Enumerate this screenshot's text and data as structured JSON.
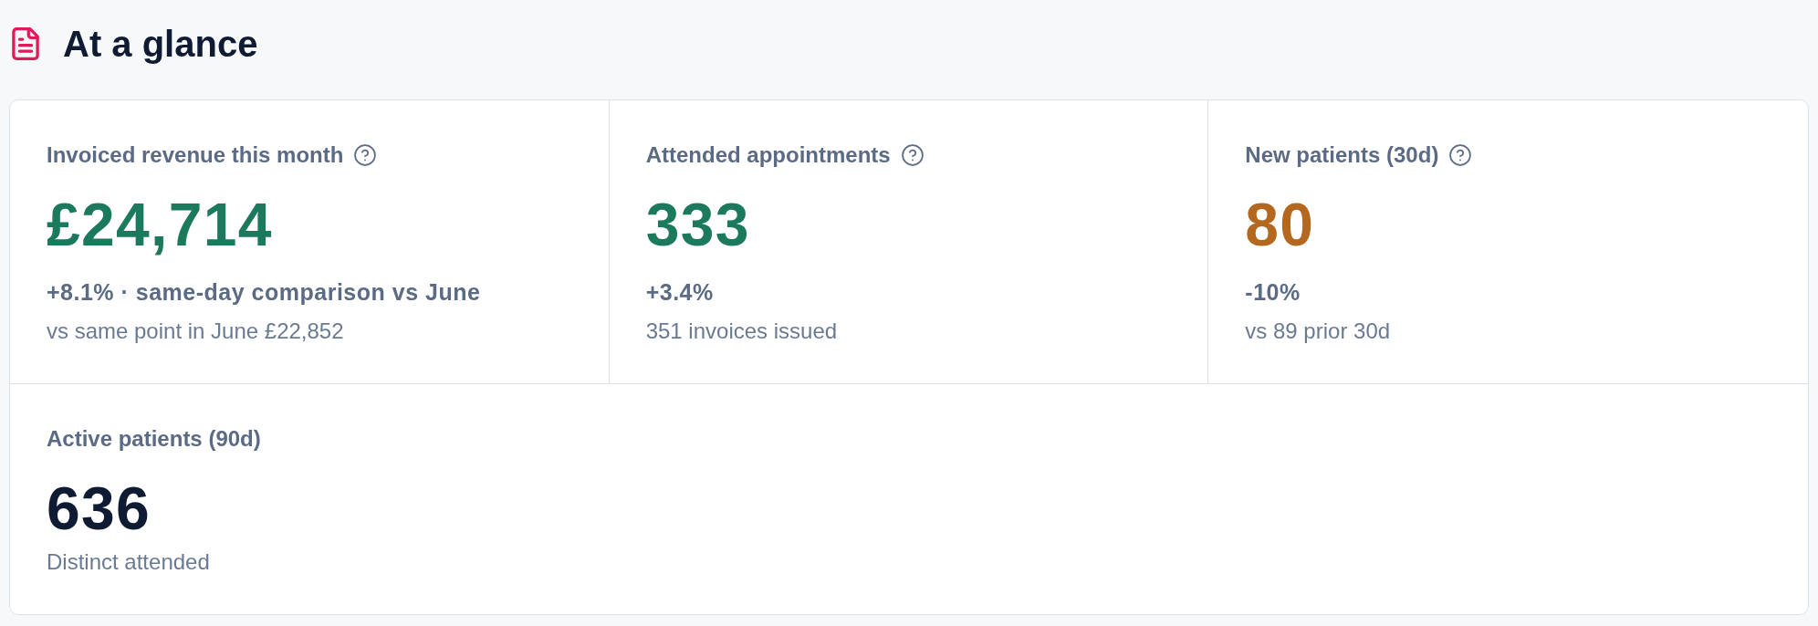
{
  "header": {
    "title": "At a glance"
  },
  "metrics": [
    {
      "label": "Invoiced revenue this month",
      "help": true,
      "value": "£24,714",
      "color": "#1b7a5c",
      "change": "+8.1% · same-day comparison vs June",
      "note": "vs same point in June £22,852"
    },
    {
      "label": "Attended appointments",
      "help": true,
      "value": "333",
      "color": "#1b7a5c",
      "change": "+3.4%",
      "note": "351 invoices issued"
    },
    {
      "label": "New patients (30d)",
      "help": true,
      "value": "80",
      "color": "#b3671f",
      "change": "-10%",
      "note": "vs 89 prior 30d"
    },
    {
      "label": "Active patients (90d)",
      "help": false,
      "value": "636",
      "color": "#0f1a33",
      "note": "Distinct attended"
    }
  ]
}
